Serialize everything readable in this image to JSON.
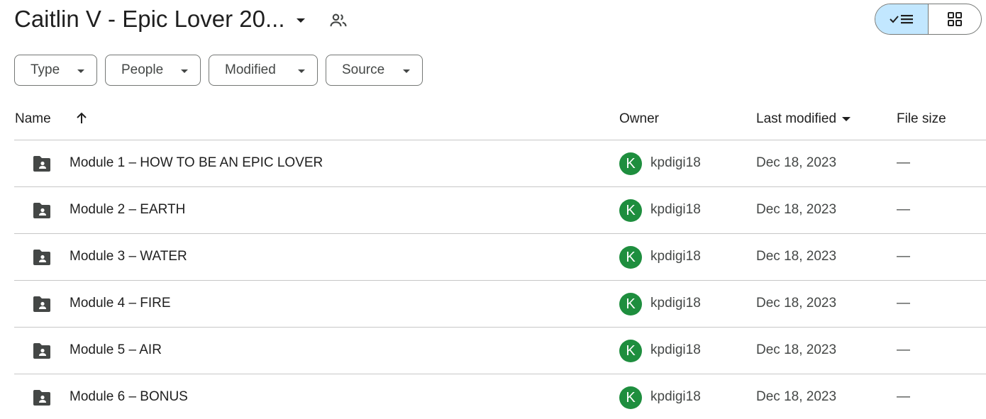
{
  "header": {
    "title": "Caitlin V - Epic Lover 20...",
    "view_toggle": {
      "list_icon": "check-list-icon",
      "grid_icon": "grid-icon"
    }
  },
  "filters": [
    {
      "label": "Type"
    },
    {
      "label": "People"
    },
    {
      "label": "Modified"
    },
    {
      "label": "Source"
    }
  ],
  "columns": {
    "name": "Name",
    "owner": "Owner",
    "last_modified": "Last modified",
    "file_size": "File size"
  },
  "rows": [
    {
      "name": "Module 1 – HOW TO BE AN EPIC LOVER",
      "owner_initial": "K",
      "owner": "kpdigi18",
      "modified": "Dec 18, 2023",
      "size": "—"
    },
    {
      "name": "Module 2 – EARTH",
      "owner_initial": "K",
      "owner": "kpdigi18",
      "modified": "Dec 18, 2023",
      "size": "—"
    },
    {
      "name": "Module 3 – WATER",
      "owner_initial": "K",
      "owner": "kpdigi18",
      "modified": "Dec 18, 2023",
      "size": "—"
    },
    {
      "name": "Module 4 – FIRE",
      "owner_initial": "K",
      "owner": "kpdigi18",
      "modified": "Dec 18, 2023",
      "size": "—"
    },
    {
      "name": "Module 5 – AIR",
      "owner_initial": "K",
      "owner": "kpdigi18",
      "modified": "Dec 18, 2023",
      "size": "—"
    },
    {
      "name": "Module 6 – BONUS",
      "owner_initial": "K",
      "owner": "kpdigi18",
      "modified": "Dec 18, 2023",
      "size": "—"
    }
  ],
  "colors": {
    "accent_toggle": "#c2e7ff",
    "avatar": "#1e8e3e",
    "folder": "#444746",
    "border": "#747775"
  }
}
